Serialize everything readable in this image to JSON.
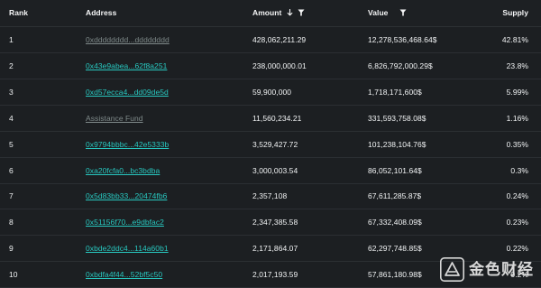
{
  "table": {
    "headers": {
      "rank": "Rank",
      "address": "Address",
      "amount": "Amount",
      "value": "Value",
      "supply": "Supply"
    },
    "sort": {
      "column": "Amount",
      "direction": "descending",
      "icon": "arrow-down-icon"
    },
    "filter_icons": [
      "filter-icon",
      "filter-icon"
    ],
    "rows": [
      {
        "rank": "1",
        "address": "0xdddddddd...dddddddd",
        "amount": "428,062,211.29",
        "value": "12,278,536,468.64$",
        "supply": "42.81%",
        "dim": true
      },
      {
        "rank": "2",
        "address": "0x43e9abea...62f8a251",
        "amount": "238,000,000.01",
        "value": "6,826,792,000.29$",
        "supply": "23.8%",
        "dim": false
      },
      {
        "rank": "3",
        "address": "0xd57ecca4...dd09de5d",
        "amount": "59,900,000",
        "value": "1,718,171,600$",
        "supply": "5.99%",
        "dim": false
      },
      {
        "rank": "4",
        "address": "Assistance Fund",
        "amount": "11,560,234.21",
        "value": "331,593,758.08$",
        "supply": "1.16%",
        "dim": true
      },
      {
        "rank": "5",
        "address": "0x9794bbbc...42e5333b",
        "amount": "3,529,427.72",
        "value": "101,238,104.76$",
        "supply": "0.35%",
        "dim": false
      },
      {
        "rank": "6",
        "address": "0xa20fcfa0...bc3bdba",
        "amount": "3,000,003.54",
        "value": "86,052,101.64$",
        "supply": "0.3%",
        "dim": false
      },
      {
        "rank": "7",
        "address": "0x5d83bb33...20474fb6",
        "amount": "2,357,108",
        "value": "67,611,285.87$",
        "supply": "0.24%",
        "dim": false
      },
      {
        "rank": "8",
        "address": "0x51156f70...e9dbfac2",
        "amount": "2,347,385.58",
        "value": "67,332,408.09$",
        "supply": "0.23%",
        "dim": false
      },
      {
        "rank": "9",
        "address": "0xbde2ddc4...114a60b1",
        "amount": "2,171,864.07",
        "value": "62,297,748.85$",
        "supply": "0.22%",
        "dim": false
      },
      {
        "rank": "10",
        "address": "0xbdfa4f44...52bf5c50",
        "amount": "2,017,193.59",
        "value": "57,861,180.98$",
        "supply": "0.2%",
        "dim": false
      }
    ]
  },
  "watermark": {
    "text": "金色财经",
    "icon": "golden-finance-logo-icon"
  },
  "colors": {
    "background": "#1c1f22",
    "text": "#f1f3f4",
    "address_link": "#28c8c0",
    "address_dim": "#7f8a8a",
    "divider": "#2b2f33"
  }
}
